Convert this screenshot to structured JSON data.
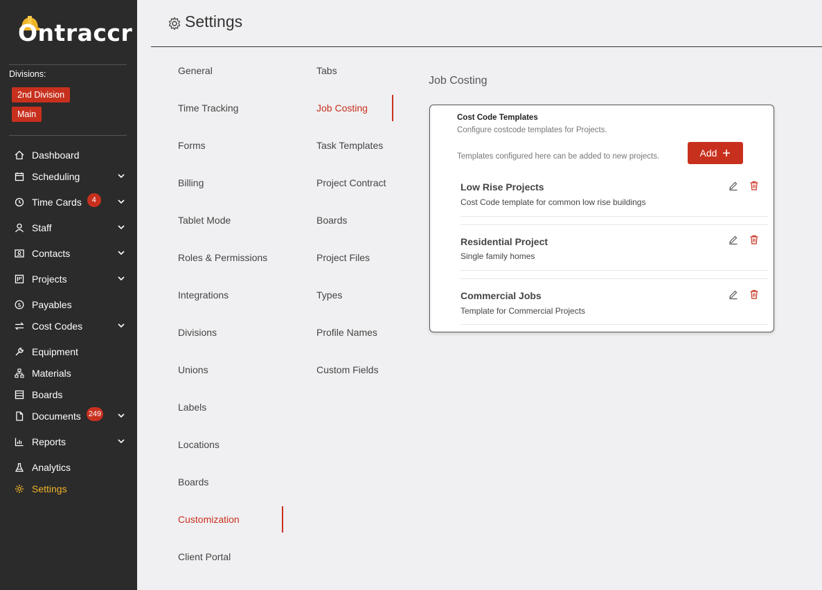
{
  "app": {
    "logo_text": "Ontraccr"
  },
  "sidebar": {
    "divisions_label": "Divisions:",
    "divisions": [
      "2nd Division",
      "Main"
    ],
    "items": [
      {
        "label": "Dashboard",
        "icon": "home-icon"
      },
      {
        "label": "Scheduling",
        "icon": "calendar-icon"
      },
      {
        "label": "Time Cards",
        "icon": "clock-icon",
        "badge": "4"
      },
      {
        "label": "Staff",
        "icon": "user-icon"
      },
      {
        "label": "Contacts",
        "icon": "contact-card-icon"
      },
      {
        "label": "Projects",
        "icon": "project-board-icon"
      },
      {
        "label": "Payables",
        "icon": "dollar-circle-icon"
      },
      {
        "label": "Cost Codes",
        "icon": "swap-icon"
      },
      {
        "label": "Equipment",
        "icon": "wrench-icon"
      },
      {
        "label": "Materials",
        "icon": "hierarchy-icon"
      },
      {
        "label": "Boards",
        "icon": "board-icon"
      },
      {
        "label": "Documents",
        "icon": "document-icon",
        "badge": "249"
      },
      {
        "label": "Reports",
        "icon": "bar-chart-icon"
      },
      {
        "label": "Analytics",
        "icon": "flask-icon"
      },
      {
        "label": "Settings",
        "icon": "gear-icon"
      }
    ]
  },
  "header": {
    "title": "Settings"
  },
  "settings_menu": {
    "col1": [
      "General",
      "Time Tracking",
      "Forms",
      "Billing",
      "Tablet Mode",
      "Roles & Permissions",
      "Integrations",
      "Divisions",
      "Unions",
      "Labels",
      "Locations",
      "Boards",
      "Customization",
      "Client Portal"
    ],
    "col2": [
      "Tabs",
      "Job Costing",
      "Task Templates",
      "Project Contract",
      "Boards",
      "Project Files",
      "Types",
      "Profile Names",
      "Custom Fields"
    ],
    "active_col1": "Customization",
    "active_col2": "Job Costing"
  },
  "content": {
    "section_title": "Job Costing",
    "card": {
      "title": "Cost Code Templates",
      "subtitle": "Configure costcode templates for Projects.",
      "description": "Templates configured here can be added to new projects.",
      "add_label": "Add",
      "templates": [
        {
          "name": "Low Rise Projects",
          "description": "Cost Code template for common low rise buildings"
        },
        {
          "name": "Residential Project",
          "description": "Single family homes"
        },
        {
          "name": "Commercial Jobs",
          "description": "Template for Commercial Projects"
        }
      ]
    }
  },
  "colors": {
    "accent": "#c8301e",
    "sidebar_bg": "#2b2b2b",
    "active_nav": "#f0b429"
  }
}
